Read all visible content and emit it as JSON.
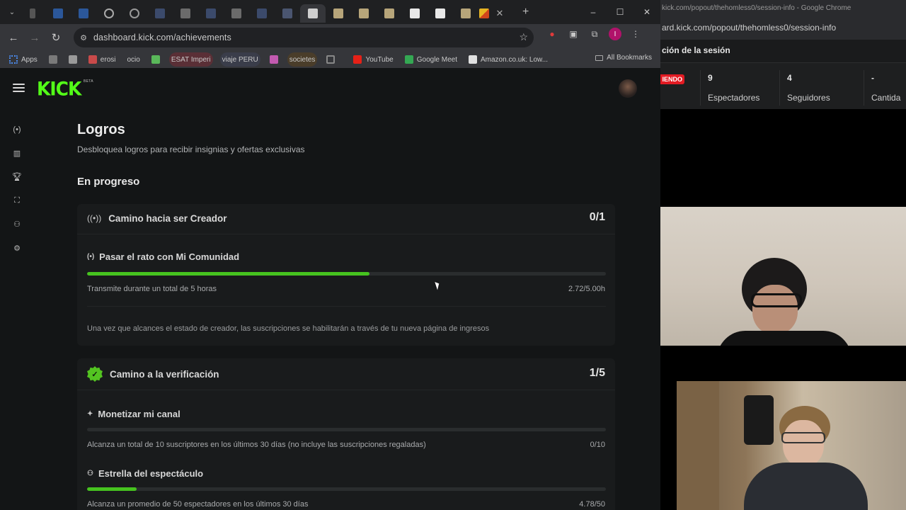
{
  "browser": {
    "url": "dashboard.kick.com/achievements",
    "bookmarks": [
      {
        "label": "Apps",
        "color": "#4b8cf0"
      },
      {
        "label": "",
        "color": "#7a7a7a"
      },
      {
        "label": "",
        "color": "#9a9a9a"
      },
      {
        "label": "erosi",
        "color": "#c94a4a"
      },
      {
        "label": "ocio",
        "color": "#b85ab8"
      },
      {
        "label": "",
        "color": "#5ab85a"
      },
      {
        "label": "ESAT Imperi",
        "color": "#d06060"
      },
      {
        "label": "viaje PERU",
        "color": "#c2c2c2"
      },
      {
        "label": "",
        "color": "#c25ab0"
      },
      {
        "label": "societes",
        "color": "#c25ab0"
      },
      {
        "label": "",
        "color": "#888"
      },
      {
        "label": "YouTube",
        "color": "#e62117"
      },
      {
        "label": "Google Meet",
        "color": "#34a853"
      },
      {
        "label": "Amazon.co.uk: Low...",
        "color": "#e0e0e0"
      }
    ],
    "all_bookmarks": "All Bookmarks"
  },
  "page": {
    "title": "Logros",
    "subtitle": "Desbloquea logros para recibir insignias y ofertas exclusivas",
    "section": "En progreso"
  },
  "cards": [
    {
      "title": "Camino hacia ser Creador",
      "count": "0/1",
      "items": [
        {
          "title": "Pasar el rato con Mi Comunidad",
          "desc": "Transmite durante un total de 5 horas",
          "value": "2.72/5.00h",
          "progress": 0.544
        }
      ],
      "note": "Una vez que alcances el estado de creador, las suscripciones se habilitarán a través de tu nueva página de ingresos"
    },
    {
      "title": "Camino a la verificación",
      "count": "1/5",
      "items": [
        {
          "title": "Monetizar mi canal",
          "desc": "Alcanza un total de 10 suscriptores en los últimos 30 días (no incluye las suscripciones regaladas)",
          "value": "0/10",
          "progress": 0.0
        },
        {
          "title": "Estrella del espectáculo",
          "desc": "Alcanza un promedio de 50 espectadores en los últimos 30 días",
          "value": "4.78/50",
          "progress": 0.0956
        }
      ]
    }
  ],
  "popout": {
    "window_title": "kick.com/popout/thehomless0/session-info - Google Chrome",
    "address": "ard.kick.com/popout/thehomless0/session-info",
    "header": "ción de la sesión",
    "live_tag": "IENDO",
    "stats": [
      {
        "num": "9",
        "label": "Espectadores"
      },
      {
        "num": "4",
        "label": "Seguidores"
      },
      {
        "num": "-",
        "label": "Cantida"
      }
    ]
  },
  "colors": {
    "kick_green": "#53fc18",
    "progress_green": "#46c31f",
    "background": "#131516"
  }
}
